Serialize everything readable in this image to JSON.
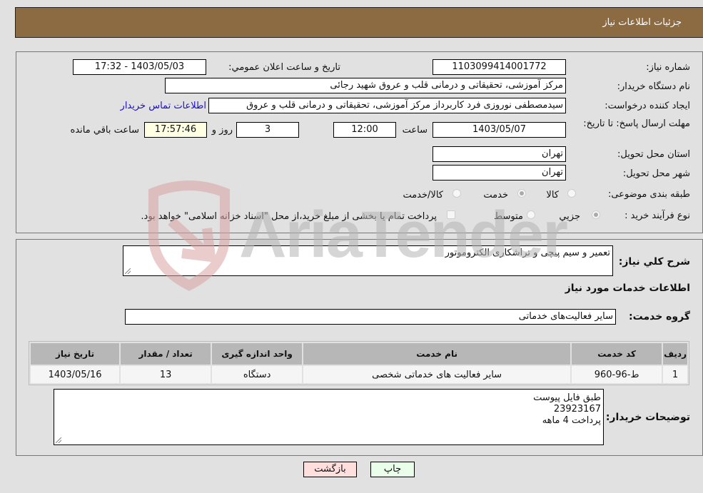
{
  "header": {
    "title": "جزئیات اطلاعات نیاز"
  },
  "details": {
    "need_number_label": "شماره نیاز:",
    "need_number": "1103099414001772",
    "announce_label": "تاریخ و ساعت اعلان عمومي:",
    "announce_value": "1403/05/03 - 17:32",
    "buyer_org_label": "نام دستگاه خریدار:",
    "buyer_org": "مرکز آموزشی، تحقیقاتی و درمانی قلب و عروق شهید رجائی",
    "creator_label": "ایجاد کننده درخواست:",
    "creator": "سیدمصطفی نوروزی فرد کاربرداز مرکز آموزشی، تحقیقاتی و درمانی قلب و عروق",
    "contact_link": "اطلاعات تماس خریدار",
    "deadline_label": "مهلت ارسال پاسخ: تا تاریخ:",
    "deadline_date": "1403/05/07",
    "time_label": "ساعت",
    "deadline_time": "12:00",
    "days": "3",
    "days_label": "روز و",
    "remaining_time": "17:57:46",
    "remaining_label": "ساعت باقي مانده",
    "province_label": "استان محل تحویل:",
    "province": "تهران",
    "city_label": "شهر محل تحویل:",
    "city": "تهران",
    "category_label": "طبقه بندی موضوعی:",
    "category_options": [
      {
        "label": "کالا",
        "selected": false
      },
      {
        "label": "خدمت",
        "selected": true
      },
      {
        "label": "کالا/خدمت",
        "selected": false
      }
    ],
    "process_label": "نوع فرآیند خرید :",
    "process_options": [
      {
        "label": "جزيي",
        "selected": true
      },
      {
        "label": "متوسط",
        "selected": false
      }
    ],
    "treasury_note": "پرداخت تمام یا بخشی از مبلغ خرید،از محل \"اسناد خزانه اسلامی\" خواهد بود."
  },
  "description": {
    "label": "شرح کلي نیاز:",
    "value": "تعمیر و سیم پیچی و تراشکاری الکتروموتور"
  },
  "services": {
    "section_title": "اطلاعات خدمات مورد نیاز",
    "group_label": "گروه خدمت:",
    "group_value": "سایر فعالیت‌های خدماتی",
    "columns": [
      "ردیف",
      "کد خدمت",
      "نام خدمت",
      "واحد اندازه گیری",
      "تعداد / مقدار",
      "تاریخ نیاز"
    ],
    "rows": [
      [
        "1",
        "ط-96-960",
        "سایر فعالیت های خدماتی شخصی",
        "دستگاه",
        "13",
        "1403/05/16"
      ]
    ]
  },
  "buyer_notes": {
    "label": "توضیحات خریدار:",
    "lines": [
      "طبق فایل پیوست",
      "23923167",
      "پرداخت 4 ماهه"
    ]
  },
  "buttons": {
    "print": "چاپ",
    "back": "بازگشت"
  },
  "watermark": {
    "text": "AriaTender.neT"
  }
}
